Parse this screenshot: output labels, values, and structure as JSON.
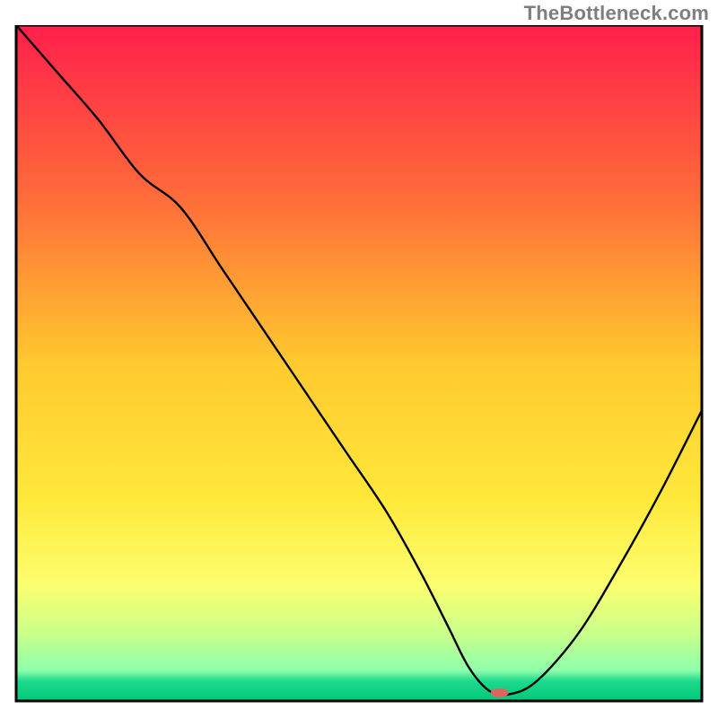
{
  "watermark": "TheBottleneck.com",
  "chart_data": {
    "type": "line",
    "title": "",
    "xlabel": "",
    "ylabel": "",
    "xlim": [
      0,
      100
    ],
    "ylim": [
      0,
      100
    ],
    "background_gradient": {
      "direction": "vertical",
      "stops": [
        {
          "pos": 0.0,
          "color": "#ff1f4b"
        },
        {
          "pos": 0.25,
          "color": "#ff6a3a"
        },
        {
          "pos": 0.5,
          "color": "#ffc92f"
        },
        {
          "pos": 0.7,
          "color": "#ffe83a"
        },
        {
          "pos": 0.83,
          "color": "#fbff6f"
        },
        {
          "pos": 0.9,
          "color": "#c9ff8a"
        },
        {
          "pos": 0.955,
          "color": "#8dffab"
        },
        {
          "pos": 0.97,
          "color": "#1fd98d"
        },
        {
          "pos": 1.0,
          "color": "#00c87a"
        }
      ]
    },
    "series": [
      {
        "name": "bottleneck-curve",
        "color": "#000000",
        "x": [
          0,
          6,
          12,
          18,
          24,
          30,
          36,
          42,
          48,
          54,
          59,
          63,
          66,
          69,
          72,
          76,
          82,
          88,
          94,
          100
        ],
        "y": [
          100,
          93,
          86,
          78,
          73,
          64,
          55,
          46,
          37,
          28,
          19,
          11,
          5,
          1.5,
          1,
          3,
          10,
          20,
          31,
          43
        ]
      }
    ],
    "marker": {
      "name": "optimal-point",
      "x": 70.5,
      "y": 1.2,
      "color": "#e0635d",
      "rx": 10,
      "ry": 5
    }
  }
}
